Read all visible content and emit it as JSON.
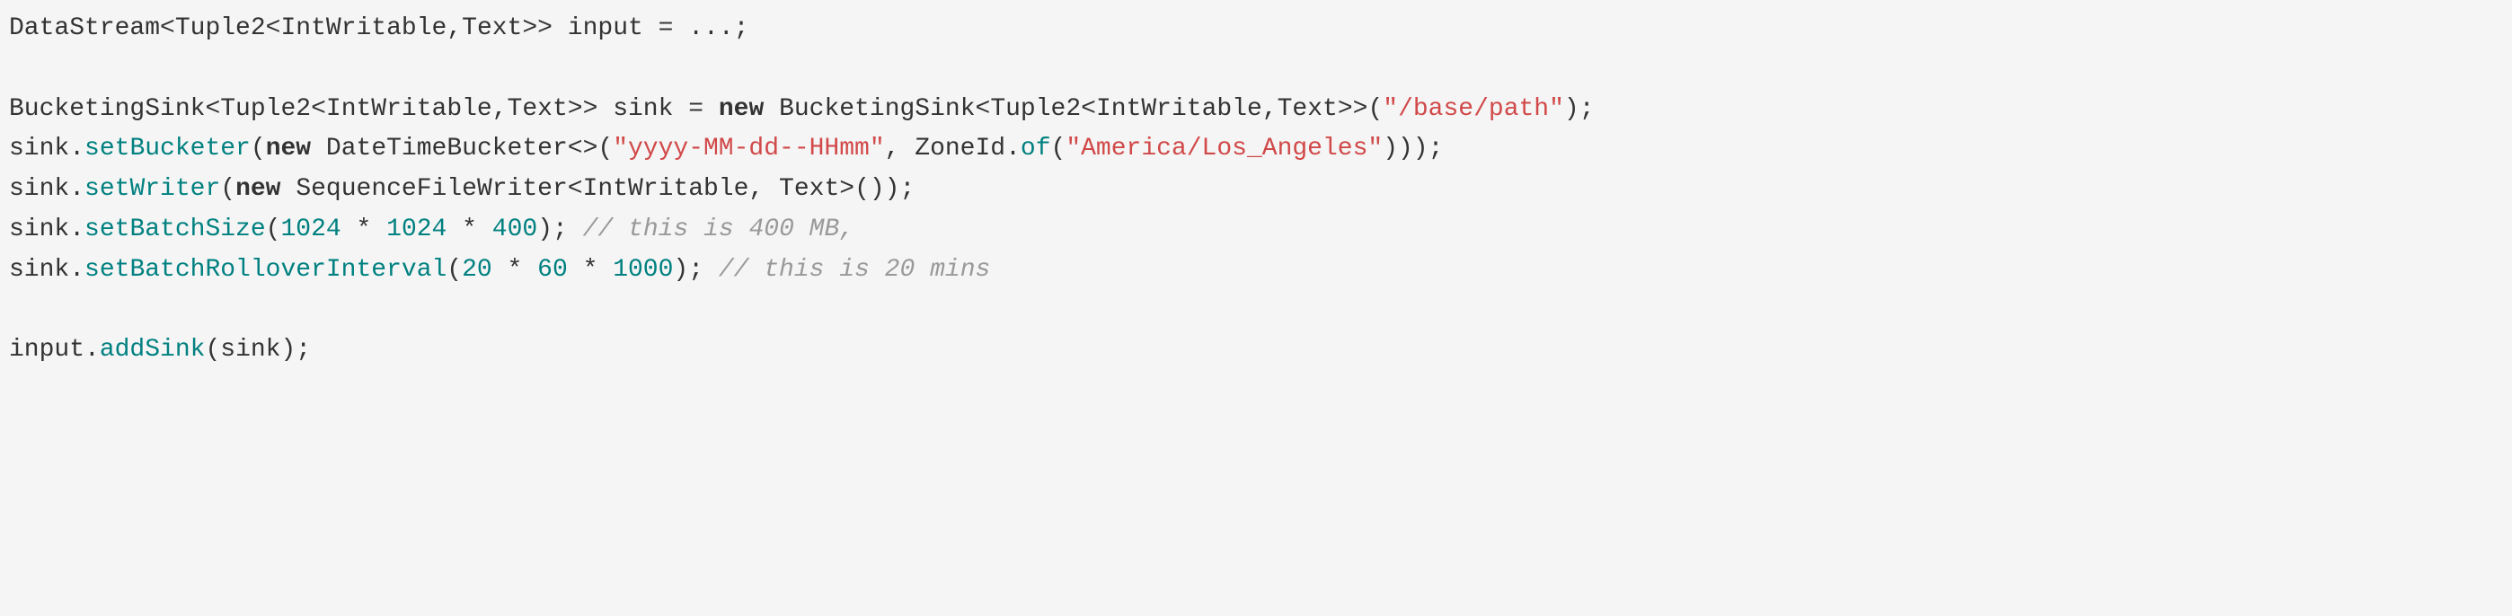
{
  "code": {
    "line1": {
      "type1": "DataStream",
      "lt1": "<",
      "type2": "Tuple2",
      "lt2": "<",
      "type3": "IntWritable",
      "comma1": ",",
      "type4": "Text",
      "gt1": ">>",
      "space1": " ",
      "var1": "input",
      "space2": " ",
      "op1": "=",
      "space3": " ",
      "ellipsis": "...;",
      "rest": ""
    },
    "line3": {
      "type1": "BucketingSink",
      "lt1": "<",
      "type2": "Tuple2",
      "lt2": "<",
      "type3": "IntWritable",
      "comma1": ",",
      "type4": "Text",
      "gt1": ">>",
      "space1": " ",
      "var1": "sink",
      "space2": " ",
      "op1": "=",
      "space3": " ",
      "keyword1": "new",
      "space4": " ",
      "type5": "BucketingSink",
      "lt3": "<",
      "type6": "Tuple2",
      "lt4": "<",
      "type7": "IntWritable",
      "comma2": ",",
      "type8": "Text",
      "gt2": ">>(",
      "string1": "\"/base/path\"",
      "close1": ");"
    },
    "line4": {
      "var1": "sink",
      "dot1": ".",
      "method1": "setBucketer",
      "open1": "(",
      "keyword1": "new",
      "space1": " ",
      "type1": "DateTimeBucketer",
      "diamond1": "<>(",
      "string1": "\"yyyy-MM-dd--HHmm\"",
      "comma1": ",",
      "space2": " ",
      "type2": "ZoneId",
      "dot2": ".",
      "method2": "of",
      "open2": "(",
      "string2": "\"America/Los_Angeles\"",
      "close1": ")));"
    },
    "line5": {
      "var1": "sink",
      "dot1": ".",
      "method1": "setWriter",
      "open1": "(",
      "keyword1": "new",
      "space1": " ",
      "type1": "SequenceFileWriter",
      "lt1": "<",
      "type2": "IntWritable",
      "comma1": ",",
      "space2": " ",
      "type3": "Text",
      "gt1": ">());"
    },
    "line6": {
      "var1": "sink",
      "dot1": ".",
      "method1": "setBatchSize",
      "open1": "(",
      "num1": "1024",
      "space1": " ",
      "op1": "*",
      "space2": " ",
      "num2": "1024",
      "space3": " ",
      "op2": "*",
      "space4": " ",
      "num3": "400",
      "close1": ");",
      "space5": " ",
      "comment1": "// this is 400 MB,"
    },
    "line7": {
      "var1": "sink",
      "dot1": ".",
      "method1": "setBatchRolloverInterval",
      "open1": "(",
      "num1": "20",
      "space1": " ",
      "op1": "*",
      "space2": " ",
      "num2": "60",
      "space3": " ",
      "op2": "*",
      "space4": " ",
      "num3": "1000",
      "close1": ");",
      "space5": " ",
      "comment1": "// this is 20 mins"
    },
    "line9": {
      "var1": "input",
      "dot1": ".",
      "method1": "addSink",
      "open1": "(",
      "var2": "sink",
      "close1": ");"
    }
  }
}
